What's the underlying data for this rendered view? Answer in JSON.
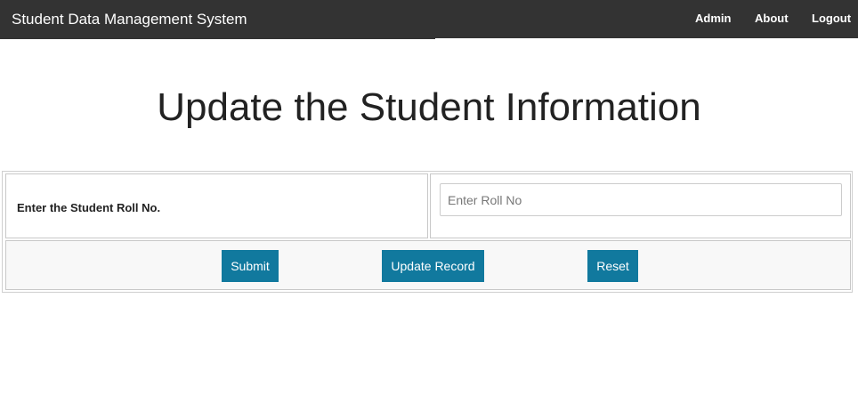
{
  "navbar": {
    "brand": "Student Data Management System",
    "links": [
      {
        "label": "Admin"
      },
      {
        "label": "About"
      },
      {
        "label": "Logout"
      }
    ]
  },
  "main": {
    "title": "Update the Student Information",
    "form": {
      "roll_label": "Enter the Student Roll No.",
      "roll_input": {
        "value": "",
        "placeholder": "Enter Roll No"
      },
      "buttons": {
        "submit": "Submit",
        "update": "Update Record",
        "reset": "Reset"
      }
    }
  },
  "colors": {
    "navbar_bg": "#333333",
    "button_bg": "#11799e",
    "button_row_bg": "#f8f8f8"
  }
}
